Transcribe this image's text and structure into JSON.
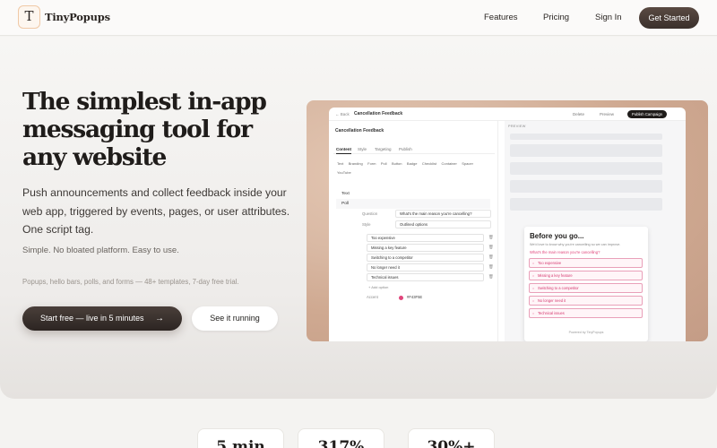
{
  "nav": {
    "logo_mark": "T",
    "brand": "TinyPopups",
    "links": [
      "Features",
      "Pricing",
      "Sign In"
    ],
    "cta": "Get Started"
  },
  "hero": {
    "headline": "The simplest in-app messaging tool for any website",
    "subheadline": "Push announcements and collect feedback inside your web app, triggered by events, pages, or user attributes. One script tag.",
    "tagline": "Simple. No bloated platform. Easy to use.",
    "meta": "Popups, hello bars, polls, and forms — 48+ templates, 7-day free trial.",
    "primary_cta": "Start free — live in 5 minutes",
    "primary_cta_arrow": "→",
    "secondary_cta": "See it running"
  },
  "mockup": {
    "back": "← Back",
    "title": "Cancellation Feedback",
    "delete": "Delete",
    "preview": "Preview",
    "publish": "Publish Campaign",
    "campaign_name": "Cancellation Feedback",
    "save": "Save",
    "tabs": [
      "Content",
      "Style",
      "Targeting",
      "Publish"
    ],
    "blocks": [
      "Text",
      "Branding",
      "Form",
      "Poll",
      "Button",
      "Badge",
      "Checklist",
      "Container",
      "Spacer",
      "YouTube"
    ],
    "tree": {
      "text": "Text",
      "poll": "Poll"
    },
    "question_label": "Question",
    "question_value": "What's the main reason you're cancelling?",
    "style_label": "Style",
    "style_value": "Outlined options",
    "options": [
      "Too expensive",
      "Missing a key feature",
      "Switching to a competitor",
      "No longer need it",
      "Technical issues"
    ],
    "add_option": "+ Add option",
    "accent_label": "Accent",
    "accent_value": "#F43F5E",
    "accent_color": "#e0457b",
    "preview_label": "PREVIEW",
    "popup": {
      "title": "Before you go...",
      "subtitle": "We'd love to know why you're cancelling so we can improve.",
      "question": "What's the main reason you're cancelling?",
      "options": [
        "Too expensive",
        "Missing a key feature",
        "Switching to a competitor",
        "No longer need it",
        "Technical issues"
      ],
      "powered_by": "Powered by TinyPopups"
    }
  },
  "stats": [
    "5 min",
    "317%",
    "30%+"
  ]
}
